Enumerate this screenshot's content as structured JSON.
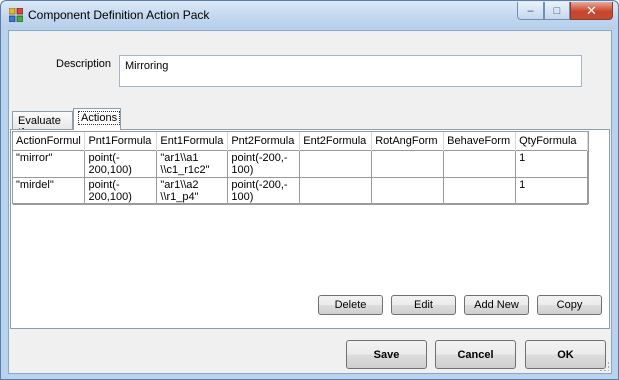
{
  "window": {
    "title": "Component Definition Action Pack",
    "minimize_glyph": "–",
    "maximize_glyph": "□",
    "close_glyph": "✕"
  },
  "description": {
    "label": "Description",
    "value": "Mirroring"
  },
  "tabs": [
    {
      "label": "Evaluate If",
      "selected": false
    },
    {
      "label": "Actions",
      "selected": true
    }
  ],
  "grid": {
    "columns": [
      "ActionFormul",
      "Pnt1Formula",
      "Ent1Formula",
      "Pnt2Formula",
      "Ent2Formula",
      "RotAngForm",
      "BehaveForm",
      "QtyFormula"
    ],
    "rows": [
      [
        "\"mirror\"",
        "point(-\n200,100)",
        "\"ar1\\\\a1\n\\\\c1_r1c2\"",
        "point(-200,-\n100)",
        "",
        "",
        "",
        "1"
      ],
      [
        "\"mirdel\"",
        "point(-\n200,100)",
        "\"ar1\\\\a2\n\\\\r1_p4\"",
        "point(-200,-\n100)",
        "",
        "",
        "",
        "1"
      ]
    ]
  },
  "buttons": {
    "delete": "Delete",
    "edit": "Edit",
    "add_new": "Add New",
    "copy": "Copy",
    "save": "Save",
    "cancel": "Cancel",
    "ok": "OK"
  },
  "colors": {
    "window_frame": "#b9d3ee",
    "client_bg": "#f0f0f0",
    "close_button": "#c9462c"
  }
}
